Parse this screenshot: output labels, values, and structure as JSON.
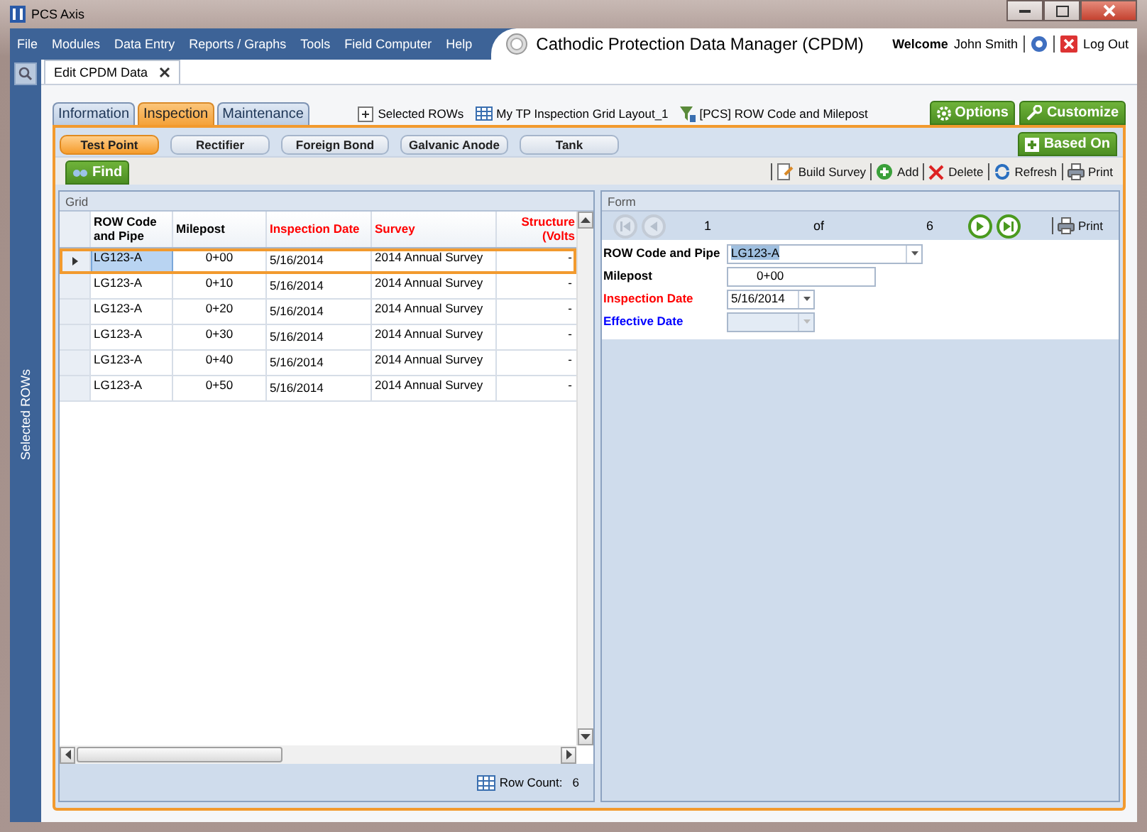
{
  "window": {
    "title": "PCS Axis"
  },
  "menu": [
    "File",
    "Modules",
    "Data Entry",
    "Reports / Graphs",
    "Tools",
    "Field Computer",
    "Help"
  ],
  "app_title": "Cathodic Protection Data Manager (CPDM)",
  "user": {
    "welcome": "Welcome",
    "name": "John Smith",
    "logout": "Log Out"
  },
  "doc_tabs": [
    {
      "label": "Edit CPDM Data",
      "selected": true
    }
  ],
  "sidebar": {
    "label": "Selected ROWs"
  },
  "section_tabs": [
    {
      "label": "Information",
      "selected": false
    },
    {
      "label": "Inspection",
      "selected": true
    },
    {
      "label": "Maintenance",
      "selected": false
    }
  ],
  "layout_links": [
    {
      "kind": "rows",
      "label": "Selected ROWs"
    },
    {
      "kind": "grid",
      "label": "My TP Inspection Grid Layout_1"
    },
    {
      "kind": "filter",
      "label": "[PCS] ROW Code and Milepost"
    }
  ],
  "top_buttons": [
    {
      "kind": "options",
      "label": "Options"
    },
    {
      "kind": "customize",
      "label": "Customize"
    }
  ],
  "sub_tabs": [
    {
      "label": "Test Point",
      "selected": true
    },
    {
      "label": "Rectifier",
      "selected": false
    },
    {
      "label": "Foreign Bond",
      "selected": false
    },
    {
      "label": "Galvanic Anode",
      "selected": false
    },
    {
      "label": "Tank",
      "selected": false
    }
  ],
  "based_on": "Based On",
  "find": "Find",
  "toolbar": [
    {
      "kind": "build",
      "label": "Build Survey"
    },
    {
      "kind": "add",
      "label": "Add"
    },
    {
      "kind": "delete",
      "label": "Delete"
    },
    {
      "kind": "refresh",
      "label": "Refresh"
    },
    {
      "kind": "print",
      "label": "Print"
    }
  ],
  "grid": {
    "title": "Grid",
    "columns": [
      {
        "label": "ROW Code and Pipe",
        "color": "#000000"
      },
      {
        "label": "Milepost",
        "color": "#000000"
      },
      {
        "label": "Inspection Date",
        "color": "#ff0000"
      },
      {
        "label": "Survey",
        "color": "#ff0000"
      },
      {
        "label": "Structure (Volts",
        "color": "#ff0000"
      }
    ],
    "rows": [
      {
        "selected": true,
        "cells": [
          "LG123-A",
          "0+00",
          "5/16/2014",
          "2014 Annual Survey",
          "-"
        ]
      },
      {
        "selected": false,
        "cells": [
          "LG123-A",
          "0+10",
          "5/16/2014",
          "2014 Annual Survey",
          "-"
        ]
      },
      {
        "selected": false,
        "cells": [
          "LG123-A",
          "0+20",
          "5/16/2014",
          "2014 Annual Survey",
          "-"
        ]
      },
      {
        "selected": false,
        "cells": [
          "LG123-A",
          "0+30",
          "5/16/2014",
          "2014 Annual Survey",
          "-"
        ]
      },
      {
        "selected": false,
        "cells": [
          "LG123-A",
          "0+40",
          "5/16/2014",
          "2014 Annual Survey",
          "-"
        ]
      },
      {
        "selected": false,
        "cells": [
          "LG123-A",
          "0+50",
          "5/16/2014",
          "2014 Annual Survey",
          "-"
        ]
      }
    ],
    "row_count_label": "Row Count:",
    "row_count": "6"
  },
  "form": {
    "title": "Form",
    "pager": {
      "current": "1",
      "of": "of",
      "total": "6",
      "first_disabled": true,
      "prev_disabled": true,
      "next_disabled": false,
      "last_disabled": false
    },
    "print": "Print",
    "fields": [
      {
        "label": "ROW Code and Pipe",
        "color": "#000000",
        "kind": "combo",
        "value": "LG123-A",
        "disabled": false
      },
      {
        "label": "Milepost",
        "color": "#000000",
        "kind": "text",
        "value": "0+00",
        "disabled": false
      },
      {
        "label": "Inspection Date",
        "color": "#ff0000",
        "kind": "date",
        "value": "5/16/2014",
        "disabled": false
      },
      {
        "label": "Effective Date",
        "color": "#0000ff",
        "kind": "date",
        "disabled": true
      }
    ]
  }
}
